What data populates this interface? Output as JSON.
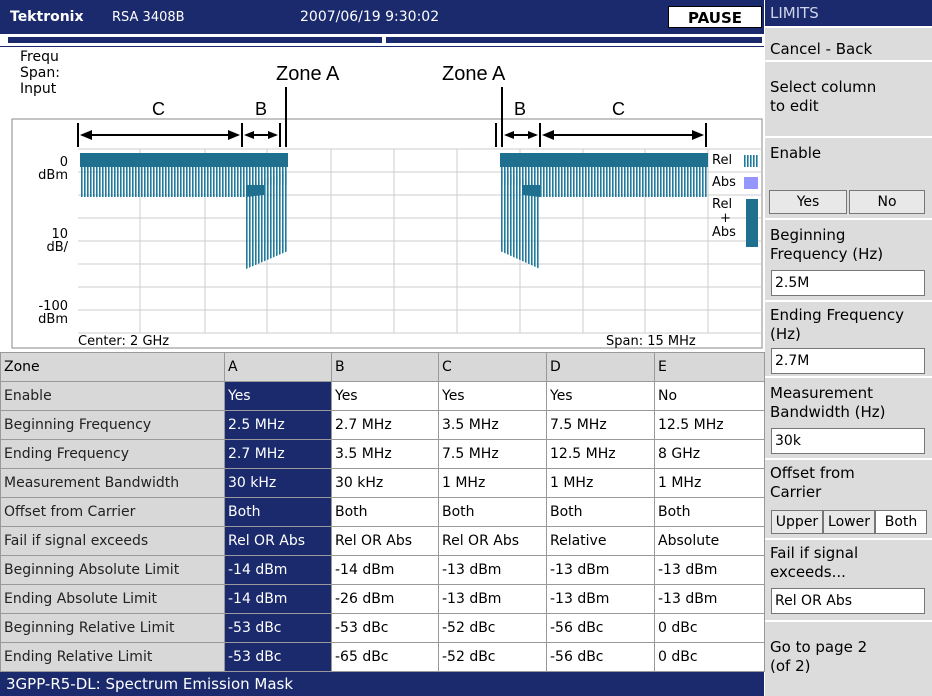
{
  "header": {
    "brand": "Tektronix",
    "model": "RSA 3408B",
    "datetime": "2007/06/19 9:30:02",
    "status": "PAUSE"
  },
  "display": {
    "freq_label": "Frequ",
    "span_label": "Span:",
    "input_label": "Input",
    "zone_a_label": "Zone A",
    "letter_c": "C",
    "letter_b": "B",
    "y_top": "0",
    "y_top_unit": "dBm",
    "y_div": "10",
    "y_div_unit": "dB/",
    "y_bot": "-100",
    "y_bot_unit": "dBm",
    "center": "Center: 2 GHz",
    "span": "Span: 15 MHz",
    "legend": {
      "rel": "Rel",
      "abs": "Abs",
      "relabs_1": "Rel",
      "relabs_2": "+",
      "relabs_3": "Abs"
    }
  },
  "table": {
    "headers": [
      "Zone",
      "A",
      "B",
      "C",
      "D",
      "E"
    ],
    "rows": [
      {
        "label": "Enable",
        "values": [
          "Yes",
          "Yes",
          "Yes",
          "Yes",
          "No"
        ]
      },
      {
        "label": "Beginning Frequency",
        "values": [
          "2.5 MHz",
          "2.7 MHz",
          "3.5 MHz",
          "7.5 MHz",
          "12.5 MHz"
        ]
      },
      {
        "label": "Ending Frequency",
        "values": [
          "2.7 MHz",
          "3.5 MHz",
          "7.5 MHz",
          "12.5 MHz",
          "8 GHz"
        ]
      },
      {
        "label": "Measurement Bandwidth",
        "values": [
          "30 kHz",
          "30 kHz",
          "1 MHz",
          "1 MHz",
          "1 MHz"
        ]
      },
      {
        "label": "Offset from Carrier",
        "values": [
          "Both",
          "Both",
          "Both",
          "Both",
          "Both"
        ]
      },
      {
        "label": "Fail if signal exceeds",
        "values": [
          "Rel OR Abs",
          "Rel OR Abs",
          "Rel OR Abs",
          "Relative",
          "Absolute"
        ]
      },
      {
        "label": "Beginning Absolute Limit",
        "values": [
          "-14 dBm",
          "-14 dBm",
          "-13 dBm",
          "-13 dBm",
          "-13 dBm"
        ]
      },
      {
        "label": "Ending Absolute Limit",
        "values": [
          "-14 dBm",
          "-26 dBm",
          "-13 dBm",
          "-13 dBm",
          "-13 dBm"
        ]
      },
      {
        "label": "Beginning Relative Limit",
        "values": [
          "-53 dBc",
          "-53 dBc",
          "-52 dBc",
          "-56 dBc",
          "0 dBc"
        ]
      },
      {
        "label": "Ending Relative Limit",
        "values": [
          "-53 dBc",
          "-65 dBc",
          "-52 dBc",
          "-56 dBc",
          "0 dBc"
        ]
      }
    ]
  },
  "status_bar": "3GPP-R5-DL: Spectrum Emission Mask",
  "side": {
    "title": "LIMITS",
    "cancel": "Cancel - Back",
    "select_1": "Select column",
    "select_2": "to edit",
    "enable": "Enable",
    "yes": "Yes",
    "no": "No",
    "beg_freq_1": "Beginning",
    "beg_freq_2": "Frequency (Hz)",
    "beg_freq_val": "2.5M",
    "end_freq_1": "Ending Frequency",
    "end_freq_2": "(Hz)",
    "end_freq_val": "2.7M",
    "mbw_1": "Measurement",
    "mbw_2": "Bandwidth (Hz)",
    "mbw_val": "30k",
    "offset_1": "Offset from",
    "offset_2": "Carrier",
    "upper": "Upper",
    "lower": "Lower",
    "both": "Both",
    "fail_1": "Fail if signal",
    "fail_2": "exceeds...",
    "fail_val": "Rel OR Abs",
    "page_1": "Go to page 2",
    "page_2": "(of 2)"
  }
}
